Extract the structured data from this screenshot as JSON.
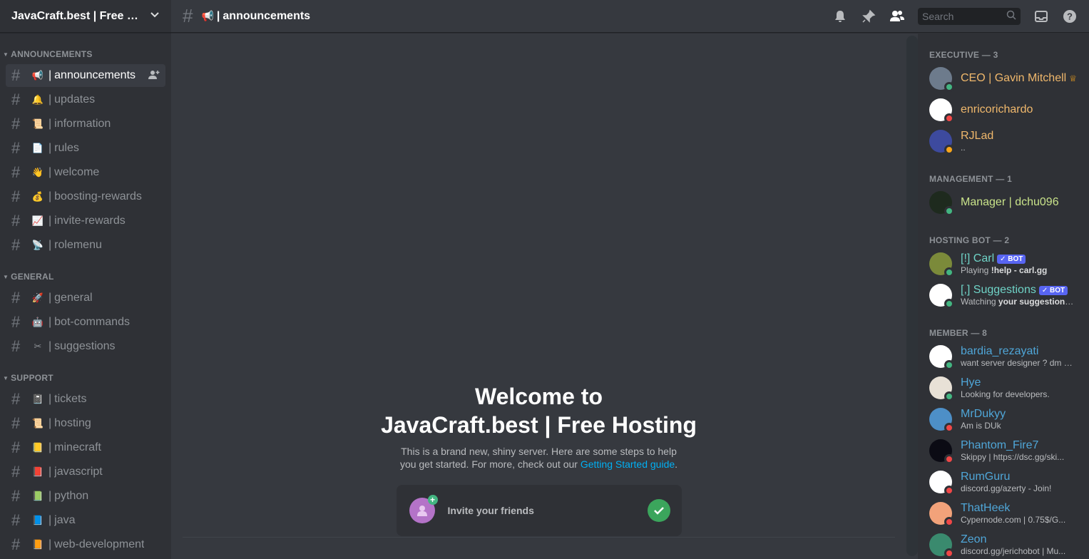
{
  "server": {
    "name": "JavaCraft.best | Free Hos..."
  },
  "categories": [
    {
      "name": "ANNOUNCEMENTS",
      "channels": [
        {
          "emoji": "📢",
          "name": "announcements",
          "active": true
        },
        {
          "emoji": "🔔",
          "name": "updates"
        },
        {
          "emoji": "📜",
          "name": "information"
        },
        {
          "emoji": "📄",
          "name": "rules"
        },
        {
          "emoji": "👋",
          "name": "welcome"
        },
        {
          "emoji": "💰",
          "name": "boosting-rewards"
        },
        {
          "emoji": "📈",
          "name": "invite-rewards"
        },
        {
          "emoji": "📡",
          "name": "rolemenu"
        }
      ]
    },
    {
      "name": "GENERAL",
      "channels": [
        {
          "emoji": "🚀",
          "name": "general"
        },
        {
          "emoji": "🤖",
          "name": "bot-commands"
        },
        {
          "emoji": "✂",
          "name": "suggestions"
        }
      ]
    },
    {
      "name": "SUPPORT",
      "channels": [
        {
          "emoji": "📓",
          "name": "tickets"
        },
        {
          "emoji": "📜",
          "name": "hosting"
        },
        {
          "emoji": "📒",
          "name": "minecraft"
        },
        {
          "emoji": "📕",
          "name": "javascript"
        },
        {
          "emoji": "📗",
          "name": "python"
        },
        {
          "emoji": "📘",
          "name": "java"
        },
        {
          "emoji": "📙",
          "name": "web-development"
        }
      ]
    }
  ],
  "topbar": {
    "emoji": "📢",
    "channel": "announcements",
    "search_placeholder": "Search"
  },
  "welcome": {
    "title_line1": "Welcome to",
    "title_line2": "JavaCraft.best | Free Hosting",
    "text": "This is a brand new, shiny server. Here are some steps to help you get started. For more, check out our ",
    "link": "Getting Started guide",
    "text_end": ".",
    "invite_label": "Invite your friends"
  },
  "member_groups": [
    {
      "title": "EXECUTIVE — 3",
      "members": [
        {
          "name": "CEO | Gavin Mitchell",
          "color": "#f0b86c",
          "status": "#43b581",
          "avatar_bg": "#6d7b8c",
          "crown": true,
          "activity": ""
        },
        {
          "name": "enricorichardo",
          "color": "#f0b86c",
          "status": "#f04747",
          "avatar_bg": "#ffffff",
          "activity": ""
        },
        {
          "name": "RJLad",
          "color": "#f0b86c",
          "status": "#faa61a",
          "avatar_bg": "#3d4a9e",
          "activity": ".."
        }
      ]
    },
    {
      "title": "MANAGEMENT — 1",
      "members": [
        {
          "name": "Manager | dchu096",
          "color": "#c9e38a",
          "status": "#43b581",
          "avatar_bg": "#1e2a1e",
          "activity": ""
        }
      ]
    },
    {
      "title": "HOSTING BOT — 2",
      "members": [
        {
          "name": "[!] Carl",
          "color": "#6fd3c7",
          "status": "#43b581",
          "avatar_bg": "#7b8a3a",
          "bot": true,
          "activity_prefix": "Playing ",
          "activity_bold": "!help - carl.gg"
        },
        {
          "name": "[,] Suggestions",
          "color": "#6fd3c7",
          "status": "#43b581",
          "avatar_bg": "#ffffff",
          "bot": true,
          "activity_prefix": "Watching ",
          "activity_bold": "your suggestions | ..."
        }
      ]
    },
    {
      "title": "MEMBER — 8",
      "members": [
        {
          "name": "bardia_rezayati",
          "color": "#4fa6d8",
          "status": "#43b581",
          "avatar_bg": "#ffffff",
          "activity": "want server designer ? dm me ..."
        },
        {
          "name": "Hye",
          "color": "#4fa6d8",
          "status": "#43b581",
          "avatar_bg": "#e8e1d6",
          "activity": "Looking for developers."
        },
        {
          "name": "MrDukyy",
          "color": "#4fa6d8",
          "status": "#f04747",
          "avatar_bg": "#4d8fc7",
          "activity": "Am is DUk"
        },
        {
          "name": "Phantom_Fire7",
          "color": "#4fa6d8",
          "status": "#f04747",
          "avatar_bg": "#0b0b14",
          "activity": "Skippy | https://dsc.gg/ski..."
        },
        {
          "name": "RumGuru",
          "color": "#4fa6d8",
          "status": "#f04747",
          "avatar_bg": "#ffffff",
          "activity": "discord.gg/azerty - Join!"
        },
        {
          "name": "ThatHeek",
          "color": "#4fa6d8",
          "status": "#f04747",
          "avatar_bg": "#f2a27a",
          "activity": "Cypernode.com | 0.75$/G..."
        },
        {
          "name": "Zeon",
          "color": "#4fa6d8",
          "status": "#f04747",
          "avatar_bg": "#3a8a6e",
          "activity": "discord.gg/jerichobot | Mu..."
        }
      ]
    }
  ]
}
